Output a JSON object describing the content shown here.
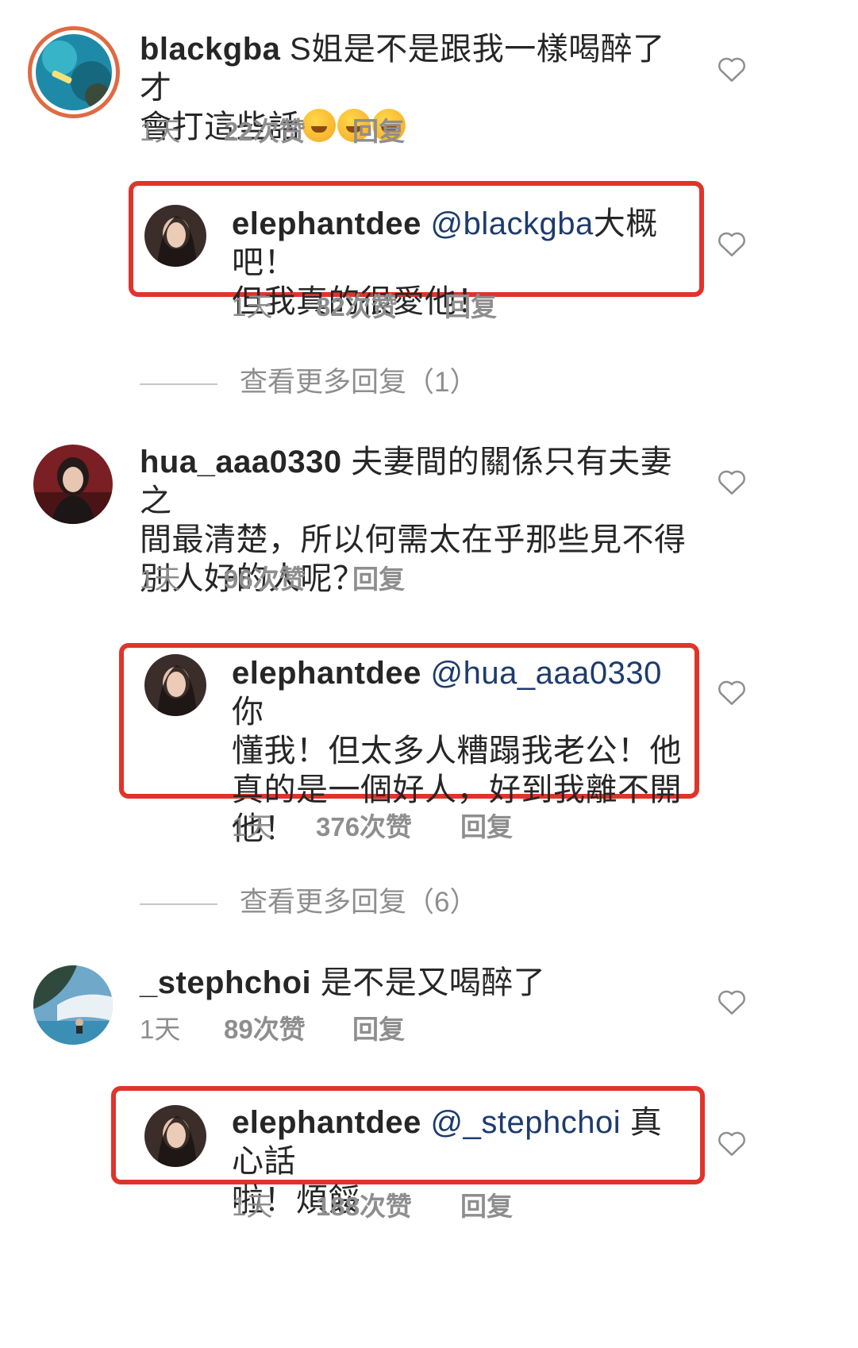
{
  "comments": [
    {
      "username": "blackgba",
      "text_line1": " S姐是不是跟我一樣喝醉了 才",
      "text_line2": "會打這些話",
      "emoji_names": [
        "rolling-on-floor-laughing-emoji",
        "rolling-on-floor-laughing-emoji",
        "rolling-on-floor-laughing-emoji"
      ],
      "time": "1天",
      "likes": "22次赞",
      "reply": "回复",
      "reply_item": {
        "username": "elephantdee",
        "mention": " @blackgba",
        "text_line1_rest": "大概吧！",
        "text_line2": "但我真的很愛他！",
        "time": "1天",
        "likes": "82次赞",
        "reply": "回复"
      },
      "view_more": "查看更多回复（1）"
    },
    {
      "username": "hua_aaa0330",
      "text_line1": " 夫妻間的關係只有夫妻之",
      "text_line2": "間最清楚，所以何需太在乎那些見不得",
      "text_line3": "別人好的人呢？",
      "time": "1天",
      "likes": "96次赞",
      "reply": "回复",
      "reply_item": {
        "username": "elephantdee",
        "mention": " @hua_aaa0330",
        "text_line1_rest": " 你",
        "text_line2": "懂我！但太多人糟蹋我老公！他",
        "text_line3": "真的是一個好人，好到我離不開",
        "text_line4": "他！",
        "time": "1天",
        "likes": "376次赞",
        "reply": "回复"
      },
      "view_more": "查看更多回复（6）"
    },
    {
      "username": "_stephchoi",
      "text_line1": " 是不是又喝醉了",
      "time": "1天",
      "likes": "89次赞",
      "reply": "回复",
      "reply_item": {
        "username": "elephantdee",
        "mention": " @_stephchoi",
        "text_line1_rest": " 真心話",
        "text_line2": "啦！煩餒",
        "time": "1天",
        "likes": "188次赞",
        "reply": "回复"
      }
    }
  ],
  "colors": {
    "highlight_border": "#e0342a",
    "mention": "#1d3b6e",
    "meta_gray": "#8e8e8e",
    "story_ring": "#e06a42"
  },
  "icons": {
    "like": "heart-outline-icon"
  }
}
